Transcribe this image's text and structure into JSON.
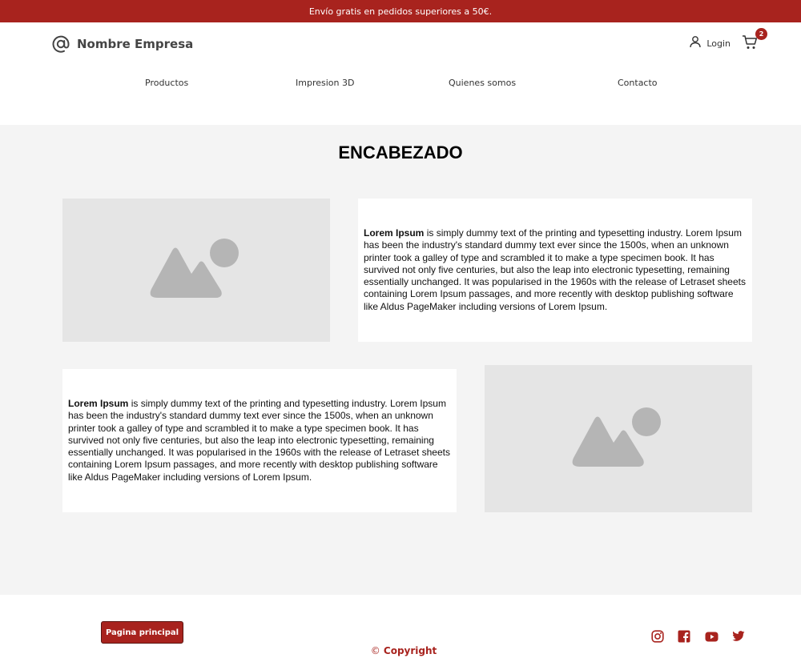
{
  "promo": {
    "text": "Envío gratis en pedidos superiores a 50€."
  },
  "brand": {
    "name": "Nombre Empresa",
    "icon": "at-icon"
  },
  "header": {
    "login_label": "Login",
    "cart_count": "2",
    "icons": [
      "user-icon",
      "cart-icon"
    ]
  },
  "nav": {
    "items": [
      {
        "label": "Productos"
      },
      {
        "label": "Impresion 3D"
      },
      {
        "label": "Quienes somos"
      },
      {
        "label": "Contacto"
      }
    ]
  },
  "main": {
    "heading": "ENCABEZADO",
    "cards": [
      {
        "bold": "Lorem Ipsum",
        "text": " is simply dummy text of the printing and typesetting industry. Lorem Ipsum has been the industry's standard dummy text ever since the 1500s, when an unknown printer took a galley of type and scrambled it to make a type specimen book. It has survived not only five centuries, but also the leap into electronic typesetting, remaining essentially unchanged. It was popularised in the 1960s with the release of Letraset sheets containing Lorem Ipsum passages, and more recently with desktop publishing software like Aldus PageMaker including versions of Lorem Ipsum."
      },
      {
        "bold": "Lorem Ipsum",
        "text": " is simply dummy text of the printing and typesetting industry. Lorem Ipsum has been the industry's standard dummy text ever since the 1500s, when an unknown printer took a galley of type and scrambled it to make a type specimen book. It has survived not only five centuries, but also the leap into electronic typesetting, remaining essentially unchanged. It was popularised in the 1960s with the release of Letraset sheets containing Lorem Ipsum passages, and more recently with desktop publishing software like Aldus PageMaker including versions of Lorem Ipsum."
      }
    ],
    "image_icon": "image-placeholder-icon"
  },
  "footer": {
    "home_button": "Pagina principal",
    "copyright_symbol": "©",
    "copyright": "Copyright",
    "social_icons": [
      "instagram-icon",
      "facebook-icon",
      "youtube-icon",
      "twitter-icon"
    ]
  },
  "colors": {
    "accent": "#a8231e",
    "content_bg": "#f4f4f4",
    "placeholder_bg": "#e5e5e5",
    "placeholder_icon": "#b5b5b5"
  }
}
